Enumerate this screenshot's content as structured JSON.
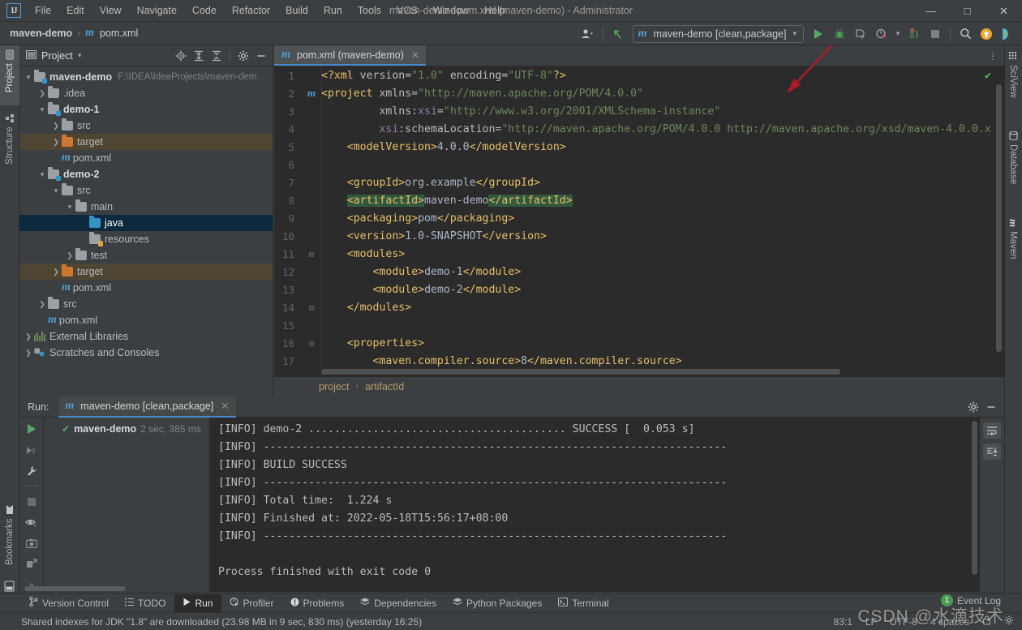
{
  "titlebar": {
    "logo": "IJ",
    "menus": [
      "File",
      "Edit",
      "View",
      "Navigate",
      "Code",
      "Refactor",
      "Build",
      "Run",
      "Tools",
      "VCS",
      "Window",
      "Help"
    ],
    "window_title": "maven-demo - pom.xml (maven-demo) - Administrator",
    "minimize": "—",
    "maximize": "□",
    "close": "✕"
  },
  "navbar": {
    "project_crumb": "maven-demo",
    "separator": "›",
    "file_crumb": "pom.xml",
    "file_icon": "m",
    "run_config": "maven-demo [clean,package]",
    "run_config_icon": "m",
    "dropdown_caret": "▾",
    "icons": {
      "profile": "person-icon",
      "back_arrow": "undo-icon",
      "run": "run-icon",
      "debug": "debug-icon",
      "run_coverage": "run-with-coverage-icon",
      "profiler": "profiler-icon",
      "build": "build-icon",
      "stop": "stop-icon",
      "search": "search-icon",
      "updates": "update-icon",
      "ai": "ai-assistant-icon"
    }
  },
  "left_strip": {
    "tabs": [
      {
        "label": "Project",
        "icon": "project-icon",
        "active": true
      },
      {
        "label": "Structure",
        "icon": "structure-icon",
        "active": false
      },
      {
        "label": "Bookmarks",
        "icon": "bookmarks-icon",
        "active": false
      }
    ]
  },
  "right_strip": {
    "tabs": [
      {
        "label": "SciView",
        "icon": "sciview-icon"
      },
      {
        "label": "Database",
        "icon": "database-icon"
      },
      {
        "label": "Maven",
        "icon": "maven-icon"
      }
    ]
  },
  "project_panel": {
    "title": "Project",
    "caret": "▾",
    "header_icons": [
      "locate-icon",
      "expand-all-icon",
      "collapse-all-icon",
      "settings-gear-icon",
      "hide-icon"
    ],
    "tree": [
      {
        "indent": 0,
        "arrow": "⌄",
        "icon": "module-folder",
        "label": "maven-demo",
        "bold": true,
        "path": "F:\\IDEA\\IdeaProjects\\maven-dem",
        "state": "normal"
      },
      {
        "indent": 1,
        "arrow": "›",
        "icon": "folder",
        "label": ".idea",
        "bold": false,
        "path": "",
        "state": "normal"
      },
      {
        "indent": 1,
        "arrow": "⌄",
        "icon": "module-folder",
        "label": "demo-1",
        "bold": true,
        "path": "",
        "state": "normal"
      },
      {
        "indent": 2,
        "arrow": "›",
        "icon": "folder",
        "label": "src",
        "bold": false,
        "path": "",
        "state": "normal"
      },
      {
        "indent": 2,
        "arrow": "›",
        "icon": "folder-orange",
        "label": "target",
        "bold": false,
        "path": "",
        "state": "target"
      },
      {
        "indent": 2,
        "arrow": "",
        "icon": "maven-file",
        "label": "pom.xml",
        "bold": false,
        "path": "",
        "state": "normal"
      },
      {
        "indent": 1,
        "arrow": "⌄",
        "icon": "module-folder",
        "label": "demo-2",
        "bold": true,
        "path": "",
        "state": "normal"
      },
      {
        "indent": 2,
        "arrow": "⌄",
        "icon": "folder",
        "label": "src",
        "bold": false,
        "path": "",
        "state": "normal"
      },
      {
        "indent": 3,
        "arrow": "⌄",
        "icon": "folder",
        "label": "main",
        "bold": false,
        "path": "",
        "state": "normal"
      },
      {
        "indent": 4,
        "arrow": "",
        "icon": "folder-blue",
        "label": "java",
        "bold": false,
        "path": "",
        "state": "selected"
      },
      {
        "indent": 4,
        "arrow": "",
        "icon": "folder-resources",
        "label": "resources",
        "bold": false,
        "path": "",
        "state": "normal"
      },
      {
        "indent": 3,
        "arrow": "›",
        "icon": "folder",
        "label": "test",
        "bold": false,
        "path": "",
        "state": "normal"
      },
      {
        "indent": 2,
        "arrow": "›",
        "icon": "folder-orange",
        "label": "target",
        "bold": false,
        "path": "",
        "state": "target"
      },
      {
        "indent": 2,
        "arrow": "",
        "icon": "maven-file",
        "label": "pom.xml",
        "bold": false,
        "path": "",
        "state": "normal"
      },
      {
        "indent": 1,
        "arrow": "›",
        "icon": "folder",
        "label": "src",
        "bold": false,
        "path": "",
        "state": "normal"
      },
      {
        "indent": 1,
        "arrow": "",
        "icon": "maven-file",
        "label": "pom.xml",
        "bold": false,
        "path": "",
        "state": "normal"
      },
      {
        "indent": 0,
        "arrow": "›",
        "icon": "libraries",
        "label": "External Libraries",
        "bold": false,
        "path": "",
        "state": "normal"
      },
      {
        "indent": 0,
        "arrow": "›",
        "icon": "scratches",
        "label": "Scratches and Consoles",
        "bold": false,
        "path": "",
        "state": "normal"
      }
    ]
  },
  "editor": {
    "tab": {
      "label": "pom.xml (maven-demo)",
      "icon": "m",
      "close": "✕"
    },
    "more_icon": "⋮",
    "inspection_ok": "✔",
    "lines": [
      {
        "n": "1",
        "fold": "",
        "marker": "",
        "tokens": [
          {
            "t": "tag",
            "v": "<?xml "
          },
          {
            "t": "attr",
            "v": "version="
          },
          {
            "t": "str",
            "v": "\"1.0\""
          },
          {
            "t": "txt",
            "v": " "
          },
          {
            "t": "attr",
            "v": "encoding="
          },
          {
            "t": "str",
            "v": "\"UTF-8\""
          },
          {
            "t": "tag",
            "v": "?>"
          }
        ]
      },
      {
        "n": "2",
        "fold": "⊖",
        "marker": "m",
        "tokens": [
          {
            "t": "tag",
            "v": "<project "
          },
          {
            "t": "attr",
            "v": "xmlns="
          },
          {
            "t": "str",
            "v": "\"http://maven.apache.org/POM/4.0.0\""
          }
        ]
      },
      {
        "n": "3",
        "fold": "",
        "marker": "",
        "tokens": [
          {
            "t": "txt",
            "v": "         "
          },
          {
            "t": "attr",
            "v": "xmlns:"
          },
          {
            "t": "ns",
            "v": "xsi"
          },
          {
            "t": "attr",
            "v": "="
          },
          {
            "t": "str",
            "v": "\"http://www.w3.org/2001/XMLSchema-instance\""
          }
        ]
      },
      {
        "n": "4",
        "fold": "",
        "marker": "",
        "tokens": [
          {
            "t": "txt",
            "v": "         "
          },
          {
            "t": "ns",
            "v": "xsi"
          },
          {
            "t": "attr",
            "v": ":schemaLocation="
          },
          {
            "t": "str",
            "v": "\"http://maven.apache.org/POM/4.0.0 http://maven.apache.org/xsd/maven-4.0.0.x"
          }
        ]
      },
      {
        "n": "5",
        "fold": "",
        "marker": "",
        "tokens": [
          {
            "t": "txt",
            "v": "    "
          },
          {
            "t": "tag",
            "v": "<modelVersion>"
          },
          {
            "t": "txt",
            "v": "4.0.0"
          },
          {
            "t": "tag",
            "v": "</modelVersion>"
          }
        ]
      },
      {
        "n": "6",
        "fold": "",
        "marker": "",
        "tokens": []
      },
      {
        "n": "7",
        "fold": "",
        "marker": "",
        "tokens": [
          {
            "t": "txt",
            "v": "    "
          },
          {
            "t": "tag",
            "v": "<groupId>"
          },
          {
            "t": "txt",
            "v": "org.example"
          },
          {
            "t": "tag",
            "v": "</groupId>"
          }
        ]
      },
      {
        "n": "8",
        "fold": "",
        "marker": "",
        "tokens": [
          {
            "t": "txt",
            "v": "    "
          },
          {
            "t": "tag hl",
            "v": "<artifactId>"
          },
          {
            "t": "txt",
            "v": "maven-demo"
          },
          {
            "t": "tag hl",
            "v": "</artifactId>"
          }
        ]
      },
      {
        "n": "9",
        "fold": "",
        "marker": "",
        "tokens": [
          {
            "t": "txt",
            "v": "    "
          },
          {
            "t": "tag",
            "v": "<packaging>"
          },
          {
            "t": "txt",
            "v": "pom"
          },
          {
            "t": "tag",
            "v": "</packaging>"
          }
        ]
      },
      {
        "n": "10",
        "fold": "",
        "marker": "",
        "tokens": [
          {
            "t": "txt",
            "v": "    "
          },
          {
            "t": "tag",
            "v": "<version>"
          },
          {
            "t": "txt",
            "v": "1.0-SNAPSHOT"
          },
          {
            "t": "tag",
            "v": "</version>"
          }
        ]
      },
      {
        "n": "11",
        "fold": "⊖",
        "marker": "",
        "tokens": [
          {
            "t": "txt",
            "v": "    "
          },
          {
            "t": "tag",
            "v": "<modules>"
          }
        ]
      },
      {
        "n": "12",
        "fold": "",
        "marker": "",
        "tokens": [
          {
            "t": "txt",
            "v": "        "
          },
          {
            "t": "tag",
            "v": "<module>"
          },
          {
            "t": "txt",
            "v": "demo-1"
          },
          {
            "t": "tag",
            "v": "</module>"
          }
        ]
      },
      {
        "n": "13",
        "fold": "",
        "marker": "",
        "tokens": [
          {
            "t": "txt",
            "v": "        "
          },
          {
            "t": "tag",
            "v": "<module>"
          },
          {
            "t": "txt",
            "v": "demo-2"
          },
          {
            "t": "tag",
            "v": "</module>"
          }
        ]
      },
      {
        "n": "14",
        "fold": "⊕",
        "marker": "",
        "tokens": [
          {
            "t": "txt",
            "v": "    "
          },
          {
            "t": "tag",
            "v": "</modules>"
          }
        ]
      },
      {
        "n": "15",
        "fold": "",
        "marker": "",
        "tokens": []
      },
      {
        "n": "16",
        "fold": "⊖",
        "marker": "",
        "tokens": [
          {
            "t": "txt",
            "v": "    "
          },
          {
            "t": "tag",
            "v": "<properties>"
          }
        ]
      },
      {
        "n": "17",
        "fold": "",
        "marker": "",
        "tokens": [
          {
            "t": "txt",
            "v": "        "
          },
          {
            "t": "tag",
            "v": "<maven.compiler.source>"
          },
          {
            "t": "txt",
            "v": "8"
          },
          {
            "t": "tag",
            "v": "</maven.compiler.source>"
          }
        ]
      }
    ],
    "breadcrumbs": [
      "project",
      "artifactId"
    ],
    "breadcrumb_sep": "›"
  },
  "run_panel": {
    "label": "Run:",
    "tab": {
      "label": "maven-demo [clean,package]",
      "icon": "m",
      "close": "✕"
    },
    "header_icons": [
      "settings-gear-icon",
      "hide-icon"
    ],
    "left_tools": [
      "rerun-icon",
      "rerun-failed-icon",
      "wrench-icon",
      "stop-icon",
      "toggle-visibility-icon",
      "screenshot-icon",
      "export-icon",
      "more-icon"
    ],
    "right_tools": [
      "soft-wrap-icon",
      "scroll-to-end-icon"
    ],
    "tree": {
      "status_icon": "✔",
      "name": "maven-demo",
      "time": "2 sec, 385 ms"
    },
    "console_lines": [
      "[INFO] demo-2 ........................................ SUCCESS [  0.053 s]",
      "[INFO] ------------------------------------------------------------------------",
      "[INFO] BUILD SUCCESS",
      "[INFO] ------------------------------------------------------------------------",
      "[INFO] Total time:  1.224 s",
      "[INFO] Finished at: 2022-05-18T15:56:17+08:00",
      "[INFO] ------------------------------------------------------------------------",
      "",
      "Process finished with exit code 0"
    ]
  },
  "toolwindow_bar": {
    "items": [
      {
        "label": "Version Control",
        "icon": "branch-icon",
        "active": false
      },
      {
        "label": "TODO",
        "icon": "todo-icon",
        "active": false
      },
      {
        "label": "Run",
        "icon": "run-icon",
        "active": true
      },
      {
        "label": "Profiler",
        "icon": "profiler-icon",
        "active": false
      },
      {
        "label": "Problems",
        "icon": "problems-icon",
        "active": false
      },
      {
        "label": "Dependencies",
        "icon": "dependencies-icon",
        "active": false
      },
      {
        "label": "Python Packages",
        "icon": "python-packages-icon",
        "active": false
      },
      {
        "label": "Terminal",
        "icon": "terminal-icon",
        "active": false
      }
    ],
    "event_log": {
      "label": "Event Log",
      "count": "1"
    }
  },
  "statusbar": {
    "message": "Shared indexes for JDK \"1.8\" are downloaded (23.98 MB in 9 sec, 830 ms) (yesterday 16:25)",
    "caret_position": "83:1",
    "line_separator": "LF",
    "encoding": "UTF-8",
    "indent": "4 spaces",
    "lock_icon": "lock-icon",
    "settings_icon": "gear-icon"
  },
  "watermark": "CSDN @水滴技术",
  "colors": {
    "accent_blue": "#4a88c7",
    "run_green": "#59a869",
    "maven_blue": "#4e9fd4",
    "target_highlight": "#4e4533",
    "selection": "#0d293e",
    "annotation_red": "#b01a28"
  }
}
